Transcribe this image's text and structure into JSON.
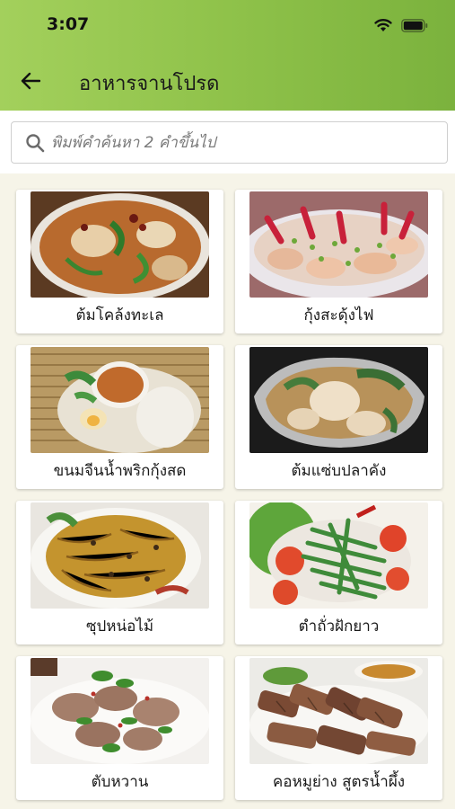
{
  "status_bar": {
    "time": "3:07"
  },
  "header": {
    "title": "อาหารจานโปรด"
  },
  "search": {
    "placeholder": "พิมพ์คำค้นหา 2 คำขึ้นไป"
  },
  "colors": {
    "app_bar": "#8fc24a",
    "background": "#f6f4e8"
  },
  "dishes": [
    {
      "name": "ต้มโคล้งทะเล",
      "image_icon": "soup-bowl-image"
    },
    {
      "name": "กุ้งสะดุ้งไฟ",
      "image_icon": "shrimp-plate-image"
    },
    {
      "name": "ขนมจีนน้ำพริกกุ้งสด",
      "image_icon": "noodle-platter-image"
    },
    {
      "name": "ต้มแซ่บปลาคัง",
      "image_icon": "fish-soup-image"
    },
    {
      "name": "ซุปหน่อไม้",
      "image_icon": "bamboo-salad-image"
    },
    {
      "name": "ตำถั่วฝักยาว",
      "image_icon": "bean-salad-image"
    },
    {
      "name": "ตับหวาน",
      "image_icon": "liver-salad-image"
    },
    {
      "name": "คอหมูย่าง สูตรน้ำผึ้ง",
      "image_icon": "grilled-pork-image"
    }
  ]
}
